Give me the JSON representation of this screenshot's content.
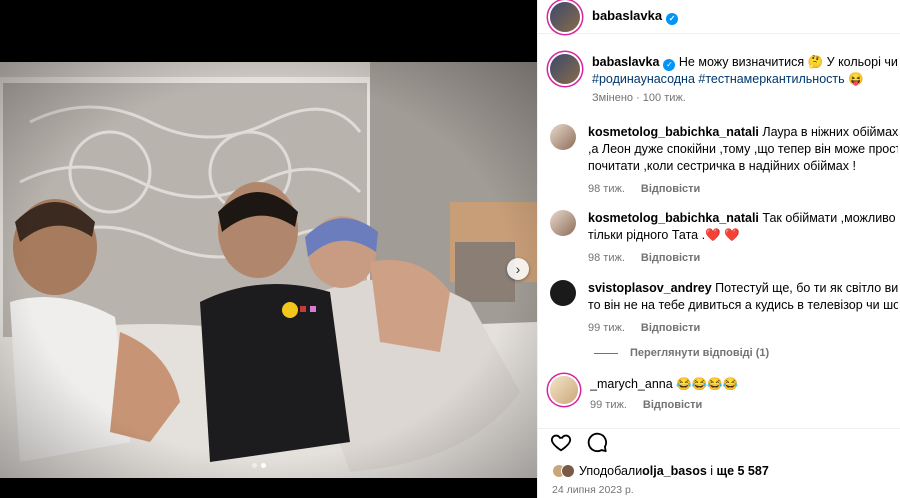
{
  "post": {
    "username": "babaslavka",
    "caption_text": "Не можу визначитися 🤔 У кольорі чи ЧБ?",
    "hashtags": "#родинаунасодна #тестнамеркантильность 😝",
    "caption_meta": "Змінено · 100 тиж."
  },
  "comments": [
    {
      "username": "kosmetolog_babichka_natali",
      "line1": "Лаура в ніжних обіймах тата",
      "line2": ",а Леон дуже спокійни ,тому ,що тепер він може просто",
      "line3": "почитати ,коли сестричка в надійних обіймах !",
      "time": "98 тиж.",
      "reply": "Відповісти"
    },
    {
      "username": "kosmetolog_babichka_natali",
      "line1": "Так обіймати ,можливо",
      "line2": "тільки рідного Тата .❤️ ❤️",
      "time": "98 тиж.",
      "reply": "Відповісти"
    },
    {
      "username": "svistoplasov_andrey",
      "line1": "Потестуй ще, бо ти як світло вимкнеш",
      "line2": "то він не на тебе дивиться а кудись в телевізор чи шо",
      "time": "99 тиж.",
      "reply": "Відповісти"
    },
    {
      "username": "_marych_anna",
      "line1": "😂😂😂😂",
      "time": "99 тиж.",
      "reply": "Відповісти"
    }
  ],
  "view_replies": "Переглянути відповіді (1)",
  "likes": {
    "prefix": "Уподобали ",
    "user": "olja_basos",
    "middle": " і ",
    "rest": "ще 5 587"
  },
  "date": "24 липня 2023 р.",
  "icons": {
    "next": "chevron-right-icon",
    "like": "heart-icon",
    "comment": "comment-icon",
    "verified": "verified-badge-icon"
  },
  "colors": {
    "verified": "#0095f6",
    "hashtag": "#00376b",
    "muted": "#737373"
  },
  "carousel": {
    "active_index": 1,
    "total": 2
  }
}
